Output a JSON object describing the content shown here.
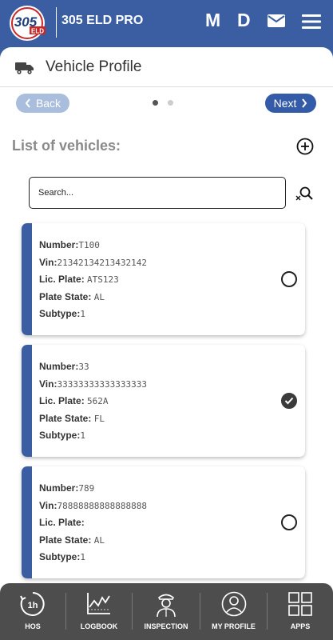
{
  "header": {
    "logo_text": "305",
    "logo_sub": "ELD",
    "app_name": "305 ELD PRO",
    "letter_m": "M",
    "letter_d": "D"
  },
  "title_bar": {
    "title": "Vehicle Profile"
  },
  "pager": {
    "back_label": "Back",
    "next_label": "Next"
  },
  "list": {
    "title": "List of vehicles:"
  },
  "search": {
    "placeholder": "Search..."
  },
  "labels": {
    "number": "Number:",
    "vin": "Vin:",
    "plate": "Lic. Plate:",
    "state": "Plate State:",
    "subtype": "Subtype:"
  },
  "vehicles": [
    {
      "number": "T100",
      "vin": "21342134213432142",
      "plate": "ATS123",
      "state": "AL",
      "subtype": "1",
      "selected": false
    },
    {
      "number": "33",
      "vin": "33333333333333333",
      "plate": "562A",
      "state": "FL",
      "subtype": "1",
      "selected": true
    },
    {
      "number": "789",
      "vin": "78888888888888888",
      "plate": "",
      "state": "AL",
      "subtype": "1",
      "selected": false
    }
  ],
  "bottom_nav": {
    "hos": "HOS",
    "hos_icon_text": "1h",
    "logbook": "LOGBOOK",
    "inspection": "INSPECTION",
    "my_profile": "MY PROFILE",
    "apps": "APPS"
  },
  "colors": {
    "brand": "#3b5ea3",
    "next_button": "#345ba8",
    "back_button": "#a9bedd",
    "nav_bg": "#4d4d4d"
  }
}
